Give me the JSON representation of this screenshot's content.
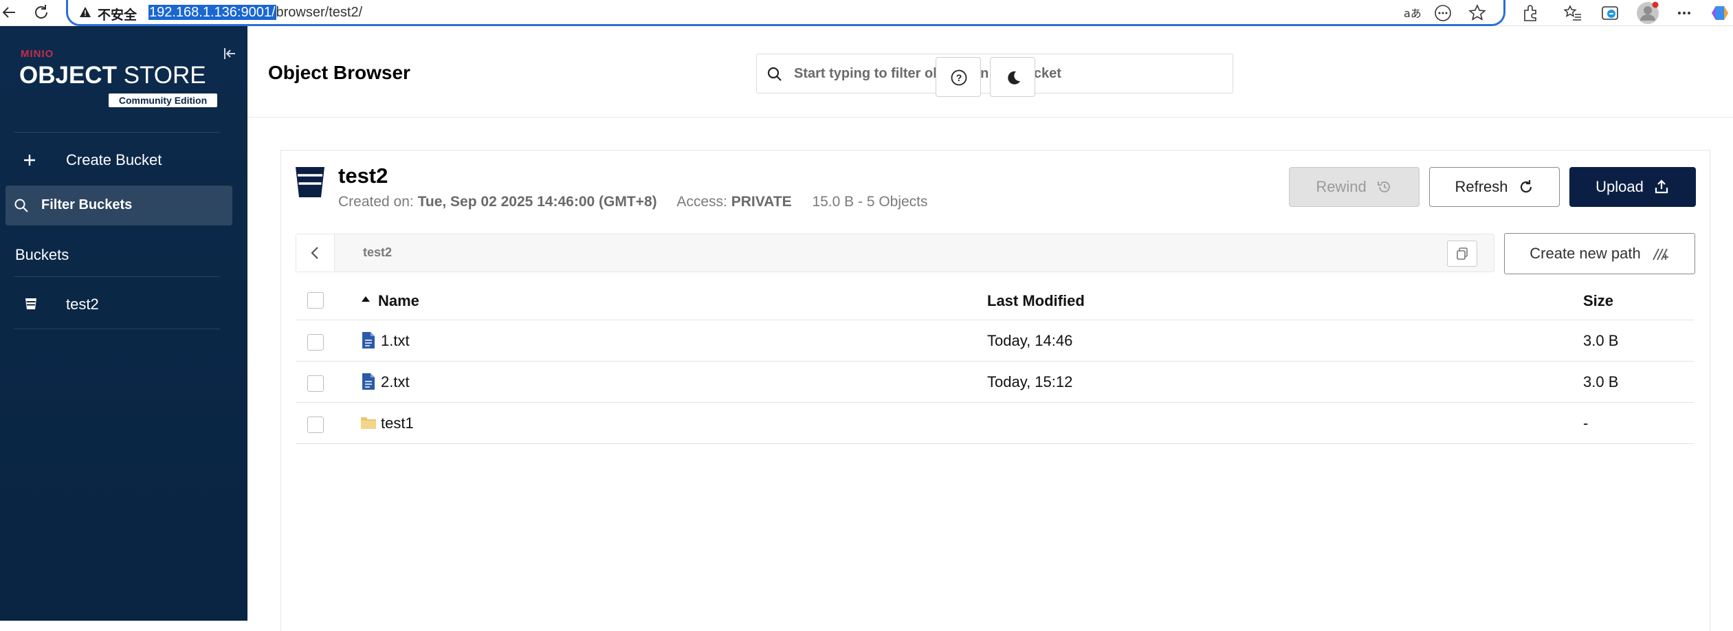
{
  "browser": {
    "security_label": "不安全",
    "url_host": "192.168.1.136:9001/",
    "url_path": "browser/test2/"
  },
  "sidebar": {
    "brand_minio": "MINIO",
    "brand_object": "OBJECT",
    "brand_store": " STORE",
    "brand_edition": "Community Edition",
    "create_bucket_label": "Create Bucket",
    "filter_buckets_label": "Filter Buckets",
    "buckets_heading": "Buckets",
    "buckets": [
      {
        "name": "test2"
      }
    ]
  },
  "header": {
    "title": "Object Browser",
    "search_placeholder": "Start typing to filter objects in the bucket"
  },
  "bucket": {
    "name": "test2",
    "created_label": "Created on:",
    "created_value": "Tue, Sep 02 2025 14:46:00 (GMT+8)",
    "access_label": "Access:",
    "access_value": "PRIVATE",
    "summary": "15.0 B - 5 Objects",
    "rewind_label": "Rewind",
    "refresh_label": "Refresh",
    "upload_label": "Upload",
    "breadcrumb": "test2",
    "create_path_label": "Create new path"
  },
  "table": {
    "columns": {
      "name": "Name",
      "modified": "Last Modified",
      "size": "Size"
    },
    "rows": [
      {
        "name": "1.txt",
        "modified": "Today, 14:46",
        "size": "3.0 B",
        "kind": "file"
      },
      {
        "name": "2.txt",
        "modified": "Today, 15:12",
        "size": "3.0 B",
        "kind": "file"
      },
      {
        "name": "test1",
        "modified": "",
        "size": "-",
        "kind": "folder"
      }
    ]
  },
  "colors": {
    "sidebar_bg": "#0b2746",
    "upload_bg": "#0b1f45",
    "brand_red": "#c72c48",
    "address_focus": "#2b6fd6"
  }
}
